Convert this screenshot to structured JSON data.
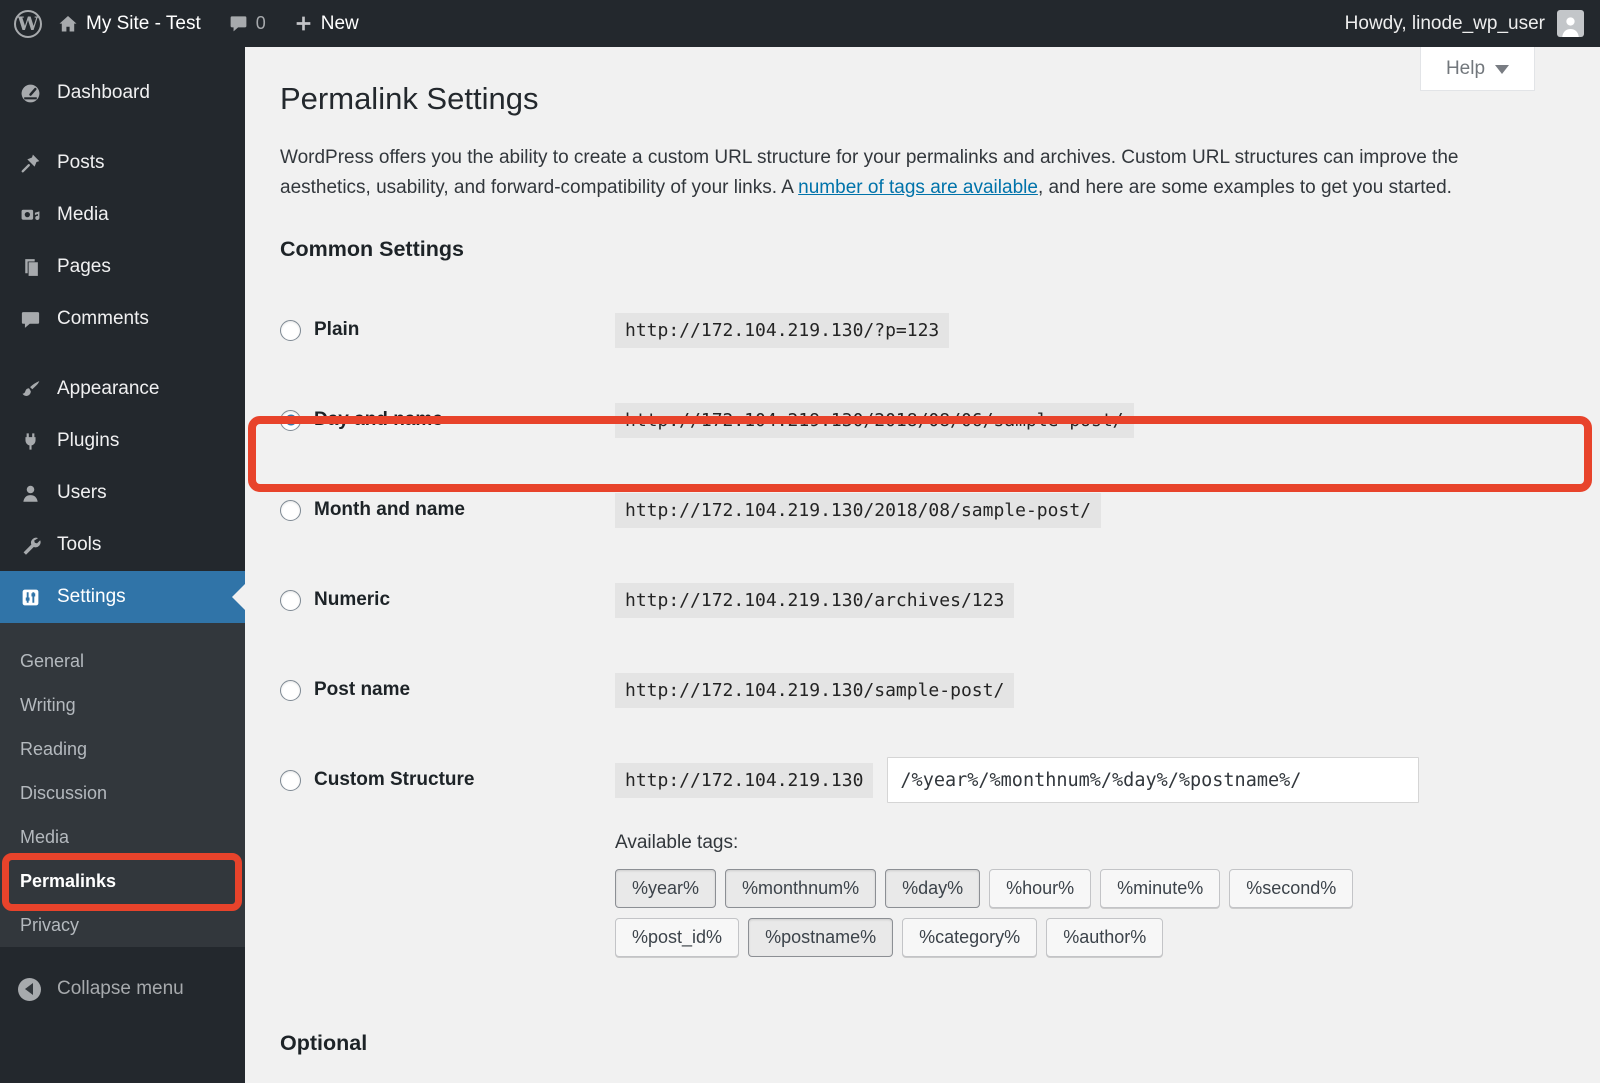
{
  "admin_bar": {
    "site_name": "My Site - Test",
    "comment_count": "0",
    "new_label": "New",
    "howdy": "Howdy, linode_wp_user"
  },
  "help": {
    "label": "Help"
  },
  "sidebar": {
    "items": [
      {
        "label": "Dashboard",
        "active": false
      },
      {
        "label": "Posts",
        "active": false
      },
      {
        "label": "Media",
        "active": false
      },
      {
        "label": "Pages",
        "active": false
      },
      {
        "label": "Comments",
        "active": false
      },
      {
        "label": "Appearance",
        "active": false
      },
      {
        "label": "Plugins",
        "active": false
      },
      {
        "label": "Users",
        "active": false
      },
      {
        "label": "Tools",
        "active": false
      },
      {
        "label": "Settings",
        "active": true
      }
    ],
    "submenu": [
      {
        "label": "General",
        "current": false
      },
      {
        "label": "Writing",
        "current": false
      },
      {
        "label": "Reading",
        "current": false
      },
      {
        "label": "Discussion",
        "current": false
      },
      {
        "label": "Media",
        "current": false
      },
      {
        "label": "Permalinks",
        "current": true
      },
      {
        "label": "Privacy",
        "current": false
      }
    ],
    "collapse_label": "Collapse menu"
  },
  "page": {
    "title": "Permalink Settings",
    "intro_before_link": "WordPress offers you the ability to create a custom URL structure for your permalinks and archives. Custom URL structures can improve the aesthetics, usability, and forward-compatibility of your links. A ",
    "intro_link": "number of tags are available",
    "intro_after_link": ", and here are some examples to get you started.",
    "common_settings_heading": "Common Settings",
    "options": [
      {
        "label": "Plain",
        "example": "http://172.104.219.130/?p=123",
        "selected": false
      },
      {
        "label": "Day and name",
        "example": "http://172.104.219.130/2018/08/06/sample-post/",
        "selected": true
      },
      {
        "label": "Month and name",
        "example": "http://172.104.219.130/2018/08/sample-post/",
        "selected": false
      },
      {
        "label": "Numeric",
        "example": "http://172.104.219.130/archives/123",
        "selected": false
      },
      {
        "label": "Post name",
        "example": "http://172.104.219.130/sample-post/",
        "selected": false
      },
      {
        "label": "Custom Structure",
        "selected": false,
        "url_prefix": "http://172.104.219.130",
        "input_value": "/%year%/%monthnum%/%day%/%postname%/"
      }
    ],
    "available_tags_label": "Available tags:",
    "tags": [
      {
        "label": "%year%",
        "used": true
      },
      {
        "label": "%monthnum%",
        "used": true
      },
      {
        "label": "%day%",
        "used": true
      },
      {
        "label": "%hour%",
        "used": false
      },
      {
        "label": "%minute%",
        "used": false
      },
      {
        "label": "%second%",
        "used": false
      },
      {
        "label": "%post_id%",
        "used": false
      },
      {
        "label": "%postname%",
        "used": true
      },
      {
        "label": "%category%",
        "used": false
      },
      {
        "label": "%author%",
        "used": false
      }
    ],
    "optional_heading": "Optional"
  },
  "colors": {
    "annotation_red": "#e8432b",
    "active_menu_blue": "#3074a8",
    "link_blue": "#0073aa",
    "admin_dark": "#23282d"
  }
}
